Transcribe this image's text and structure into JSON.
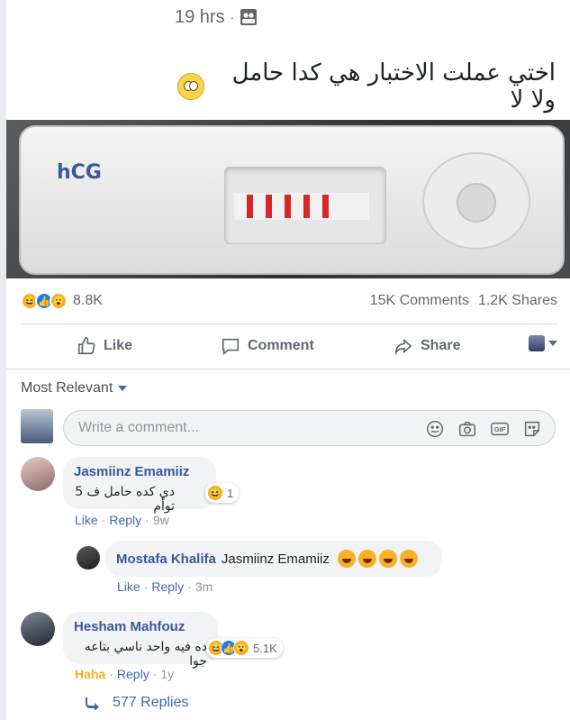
{
  "post": {
    "time": "19 hrs",
    "separator": "·",
    "audience_icon": "group-audience-icon",
    "text": "اختي عملت الاختبار هي كدا حامل ولا لا",
    "text_emoji": "face-with-rolling-eyes-emoji",
    "photo": {
      "brand_text": "hCG"
    }
  },
  "stats": {
    "reaction_count": "8.8K",
    "comments": "15K Comments",
    "shares": "1.2K Shares",
    "reaction_icons": [
      "haha-icon",
      "like-icon",
      "wow-icon"
    ]
  },
  "actions": {
    "like": "Like",
    "comment": "Comment",
    "share": "Share"
  },
  "comments_section": {
    "sort_label": "Most Relevant",
    "composer_placeholder": "Write a comment..."
  },
  "comments": [
    {
      "author": "Jasmiinz Emamiiz",
      "text": "دي كده حامل ف 5 توأم",
      "reaction_count": "1",
      "like": "Like",
      "reply": "Reply",
      "time": "9w"
    },
    {
      "author": "Mostafa Khalifa",
      "text": "Jasmiinz Emamiiz",
      "like": "Like",
      "reply": "Reply",
      "time": "3m"
    },
    {
      "author": "Hesham Mahfouz",
      "text": "ده فيه واحد ناسي بتاعه جوا",
      "reaction_count": "5.1K",
      "like": "Haha",
      "reply": "Reply",
      "time": "1y"
    }
  ],
  "replies_link": "577 Replies",
  "colors": {
    "link_blue": "#4267b2",
    "name_blue": "#385898",
    "haha_yellow": "#f7b125",
    "like_blue": "#2078f4",
    "test_line_red": "#d92626"
  }
}
